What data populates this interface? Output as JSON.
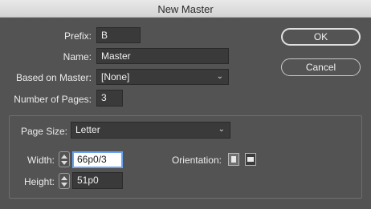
{
  "window": {
    "title": "New Master"
  },
  "form": {
    "prefix_label": "Prefix:",
    "prefix_value": "B",
    "name_label": "Name:",
    "name_value": "Master",
    "based_on_label": "Based on Master:",
    "based_on_value": "[None]",
    "pages_label": "Number of Pages:",
    "pages_value": "3"
  },
  "buttons": {
    "ok": "OK",
    "cancel": "Cancel"
  },
  "page_size": {
    "label": "Page Size:",
    "value": "Letter",
    "width_label": "Width:",
    "width_value": "66p0/3",
    "height_label": "Height:",
    "height_value": "51p0",
    "orientation_label": "Orientation:",
    "orientation_options": [
      "portrait-icon",
      "landscape-icon"
    ],
    "orientation_selected": "landscape"
  },
  "colors": {
    "dialog_bg": "#535353",
    "field_bg": "#3a3a3a",
    "focus_ring": "#6aa4ee"
  }
}
